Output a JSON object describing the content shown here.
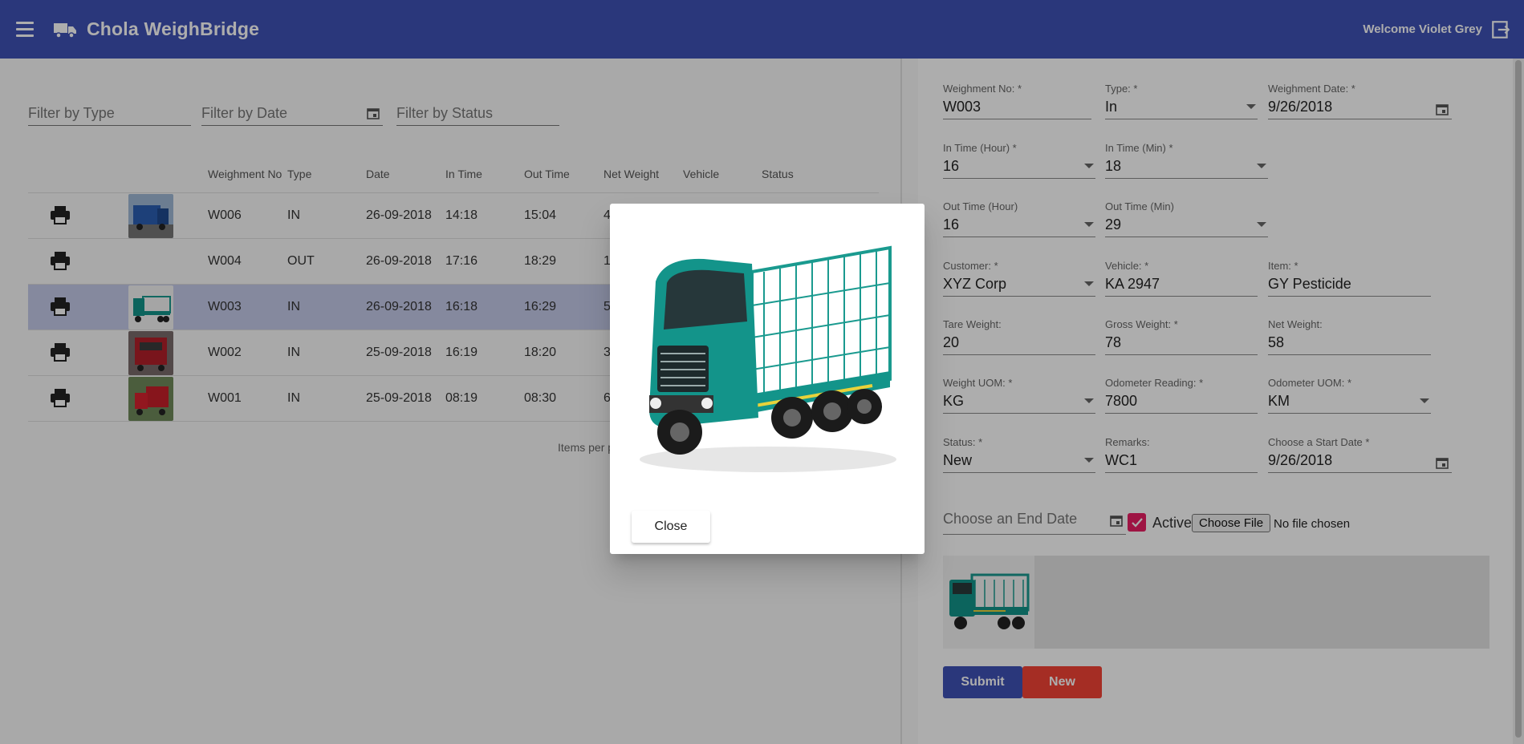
{
  "app": {
    "title": "Chola WeighBridge",
    "welcome": "Welcome Violet Grey",
    "accent": "#3f51b5",
    "menu_icon": "menu-icon",
    "logo_icon": "truck-icon",
    "logout_icon": "logout-icon"
  },
  "filters": {
    "type_placeholder": "Filter by Type",
    "date_placeholder": "Filter by Date",
    "status_placeholder": "Filter by Status"
  },
  "table": {
    "columns": [
      "Weighment No",
      "Type",
      "Date",
      "In Time",
      "Out Time",
      "Net Weight",
      "Vehicle",
      "Status"
    ],
    "rows": [
      {
        "no": "W006",
        "type": "IN",
        "date": "26-09-2018",
        "in": "14:18",
        "out": "15:04",
        "net": "4",
        "thumb": "blue-truck"
      },
      {
        "no": "W004",
        "type": "OUT",
        "date": "26-09-2018",
        "in": "17:16",
        "out": "18:29",
        "net": "1",
        "thumb": ""
      },
      {
        "no": "W003",
        "type": "IN",
        "date": "26-09-2018",
        "in": "16:18",
        "out": "16:29",
        "net": "5",
        "thumb": "green-truck"
      },
      {
        "no": "W002",
        "type": "IN",
        "date": "25-09-2018",
        "in": "16:19",
        "out": "18:20",
        "net": "3",
        "thumb": "red-truck"
      },
      {
        "no": "W001",
        "type": "IN",
        "date": "25-09-2018",
        "in": "08:19",
        "out": "08:30",
        "net": "6",
        "thumb": "red-truck-2"
      }
    ],
    "items_per_page": "Items per p"
  },
  "form": {
    "weighment_no": {
      "label": "Weighment No: *",
      "value": "W003"
    },
    "type": {
      "label": "Type: *",
      "value": "In"
    },
    "weighment_date": {
      "label": "Weighment Date: *",
      "value": "9/26/2018"
    },
    "in_hour": {
      "label": "In Time (Hour) *",
      "value": "16"
    },
    "in_min": {
      "label": "In Time (Min) *",
      "value": "18"
    },
    "out_hour": {
      "label": "Out Time (Hour)",
      "value": "16"
    },
    "out_min": {
      "label": "Out Time (Min)",
      "value": "29"
    },
    "customer": {
      "label": "Customer: *",
      "value": "XYZ Corp"
    },
    "vehicle": {
      "label": "Vehicle: *",
      "value": "KA 2947"
    },
    "item": {
      "label": "Item: *",
      "value": "GY Pesticide"
    },
    "tare": {
      "label": "Tare Weight:",
      "value": "20"
    },
    "gross": {
      "label": "Gross Weight: *",
      "value": "78"
    },
    "net": {
      "label": "Net Weight:",
      "value": "58"
    },
    "uom": {
      "label": "Weight UOM: *",
      "value": "KG"
    },
    "odometer": {
      "label": "Odometer Reading: *",
      "value": "7800"
    },
    "odo_uom": {
      "label": "Odometer UOM: *",
      "value": "KM"
    },
    "status": {
      "label": "Status: *",
      "value": "New"
    },
    "remarks": {
      "label": "Remarks:",
      "value": "WC1"
    },
    "start_date": {
      "label": "Choose a Start Date *",
      "value": "9/26/2018"
    },
    "end_date_placeholder": "Choose an End Date",
    "active_label": "Active",
    "active_checked": true,
    "choose_file": "Choose File",
    "no_file": "No file chosen",
    "submit": "Submit",
    "new": "New",
    "checkbox_color": "#e91e63",
    "new_color": "#f44336"
  },
  "dialog": {
    "close": "Close",
    "image": "green-truck"
  }
}
